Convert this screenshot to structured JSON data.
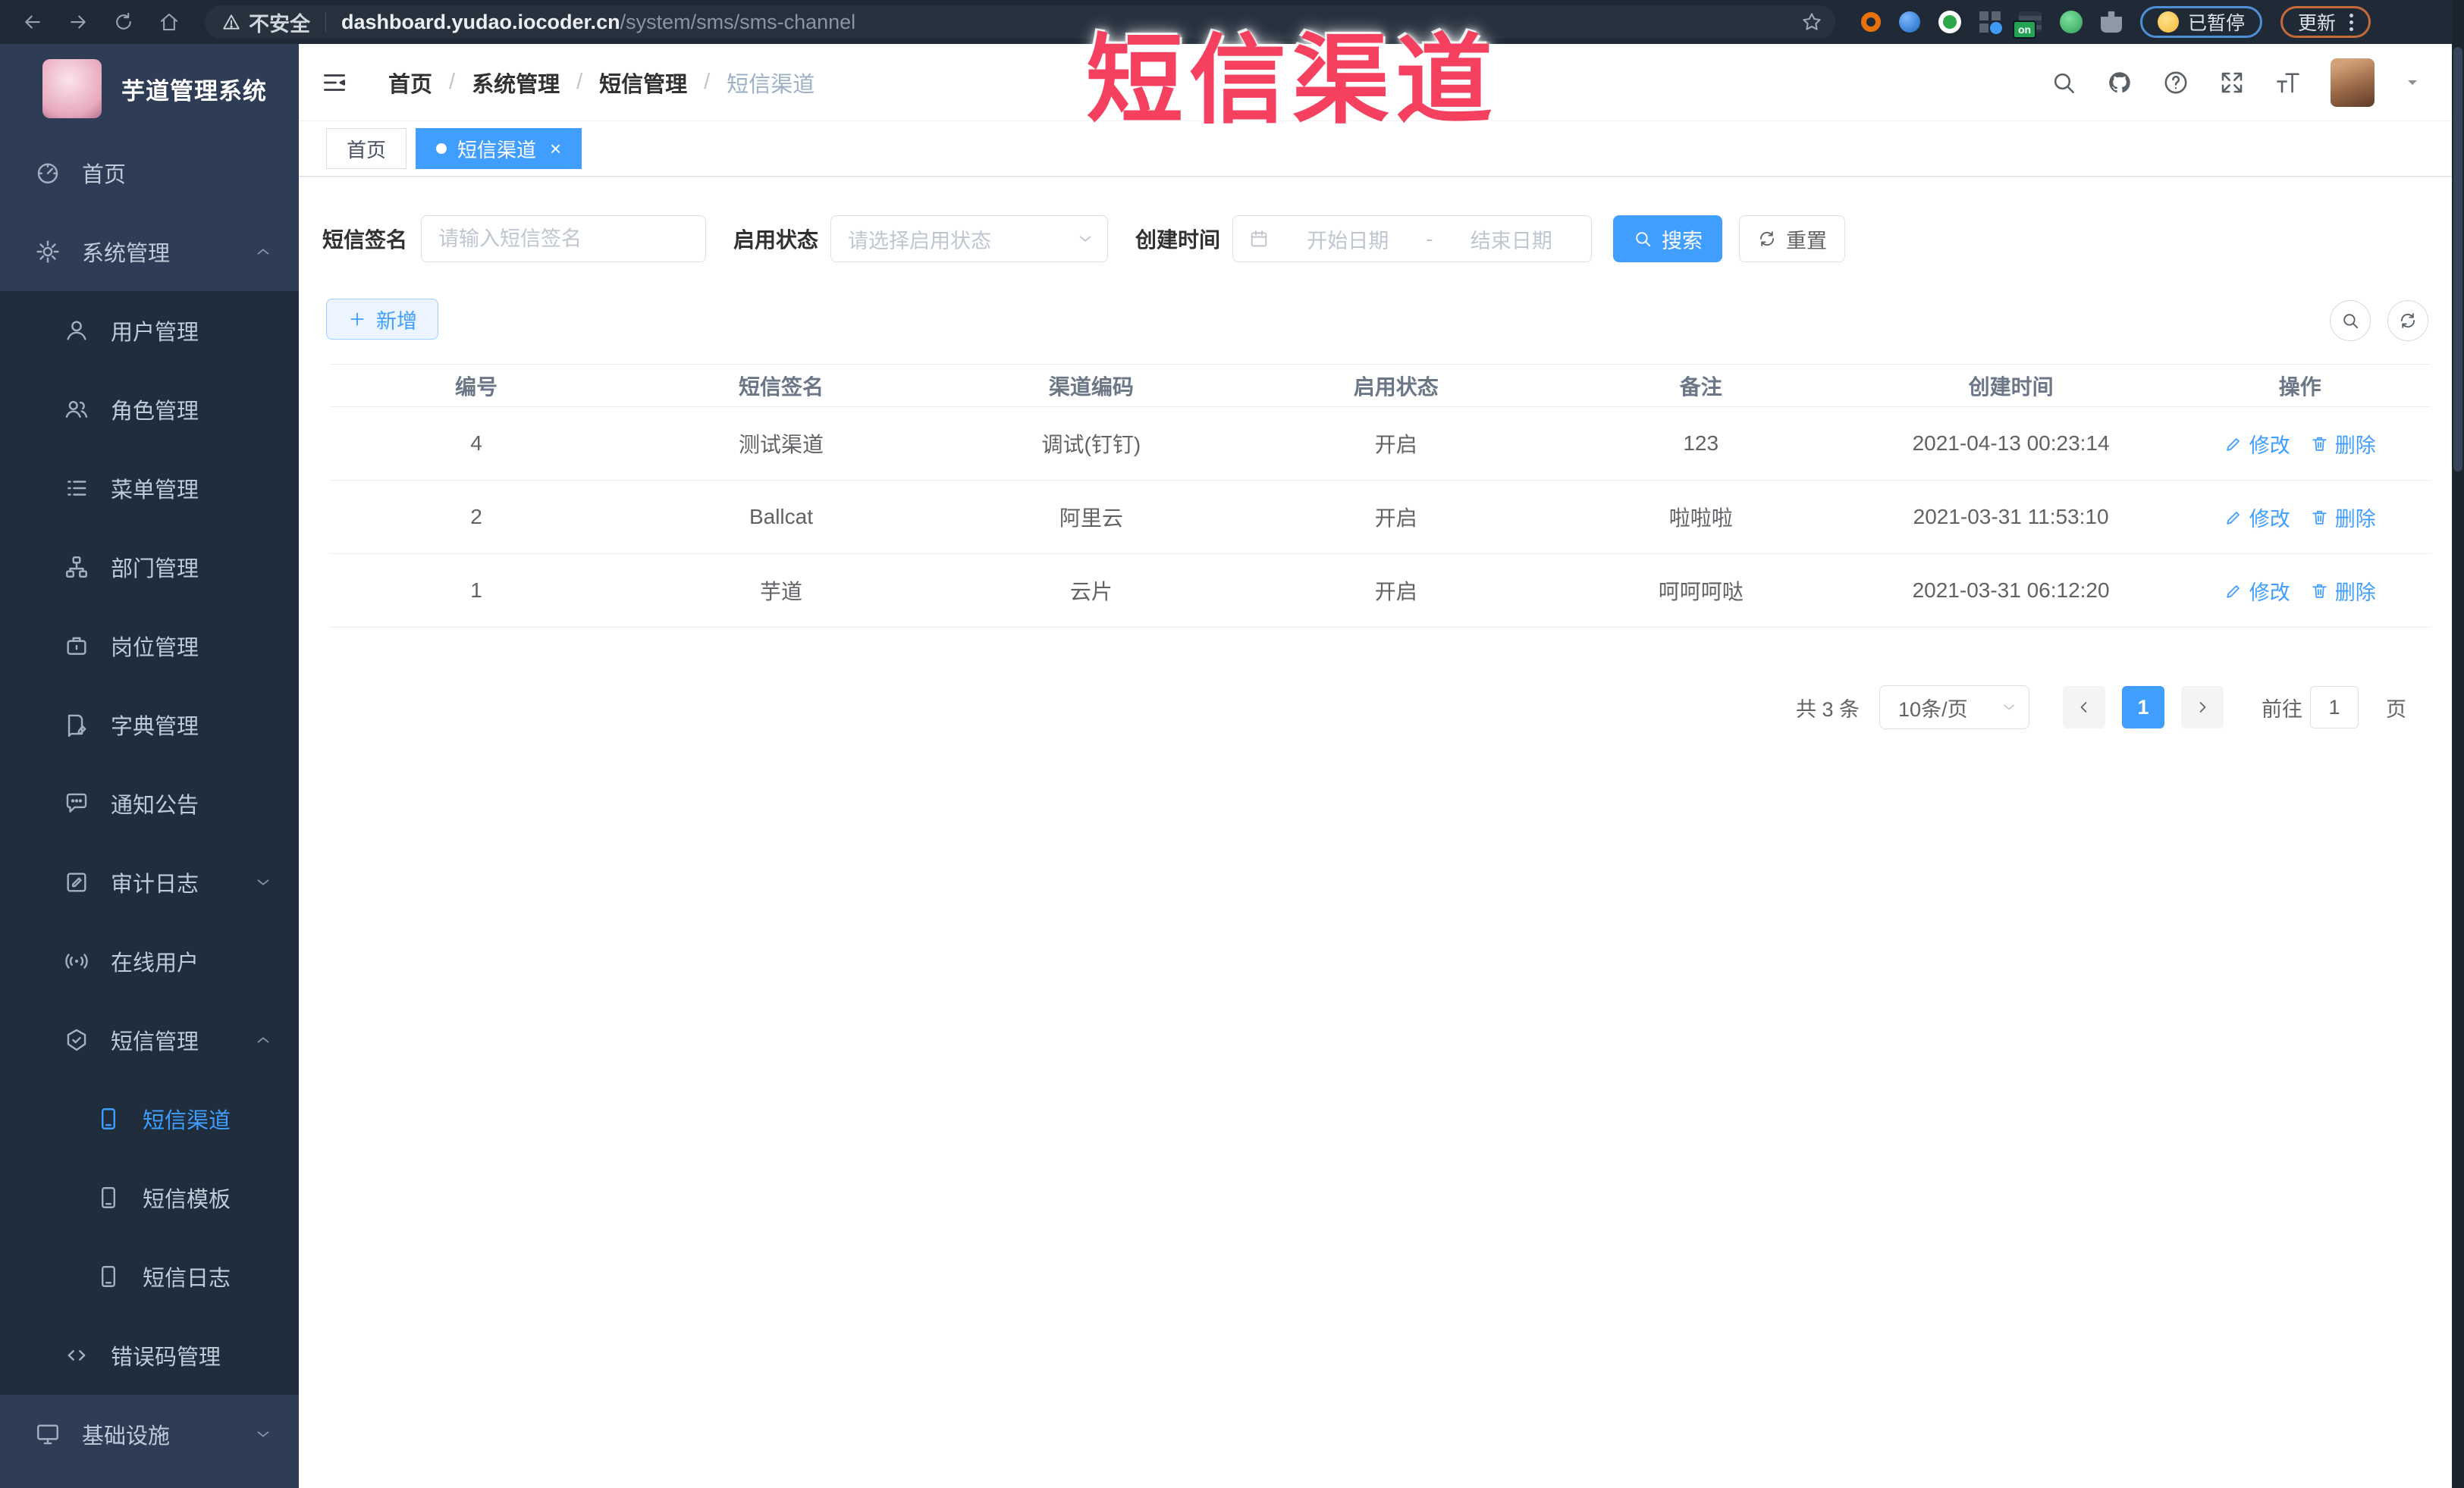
{
  "browser": {
    "security_label": "不安全",
    "url_domain": "dashboard.yudao.iocoder.cn",
    "url_path": "/system/sms/sms-channel",
    "on_badge": "on",
    "paused_label": "已暂停",
    "update_label": "更新"
  },
  "overlay": {
    "title": "短信渠道"
  },
  "sidebar": {
    "logo_title": "芋道管理系统",
    "items": [
      {
        "label": "首页",
        "icon": "dashboard-icon"
      },
      {
        "label": "系统管理",
        "icon": "gear-icon",
        "chevron": "up"
      },
      {
        "label": "用户管理",
        "icon": "user-icon"
      },
      {
        "label": "角色管理",
        "icon": "users-icon"
      },
      {
        "label": "菜单管理",
        "icon": "list-icon"
      },
      {
        "label": "部门管理",
        "icon": "tree-icon"
      },
      {
        "label": "岗位管理",
        "icon": "briefcase-icon"
      },
      {
        "label": "字典管理",
        "icon": "book-icon"
      },
      {
        "label": "通知公告",
        "icon": "chat-icon"
      },
      {
        "label": "审计日志",
        "icon": "edit-icon",
        "chevron": "down"
      },
      {
        "label": "在线用户",
        "icon": "signal-icon"
      },
      {
        "label": "短信管理",
        "icon": "shield-icon",
        "chevron": "up"
      },
      {
        "label": "短信渠道",
        "icon": "phone-icon",
        "active": true
      },
      {
        "label": "短信模板",
        "icon": "phone-icon"
      },
      {
        "label": "短信日志",
        "icon": "phone-icon"
      },
      {
        "label": "错误码管理",
        "icon": "code-icon"
      },
      {
        "label": "基础设施",
        "icon": "monitor-icon",
        "chevron": "down"
      }
    ]
  },
  "breadcrumb": {
    "separator": "/",
    "items": [
      "首页",
      "系统管理",
      "短信管理",
      "短信渠道"
    ]
  },
  "tabs": {
    "close_glyph": "×",
    "items": [
      {
        "label": "首页",
        "active": false
      },
      {
        "label": "短信渠道",
        "active": true
      }
    ]
  },
  "filters": {
    "sign_label": "短信签名",
    "sign_placeholder": "请输入短信签名",
    "status_label": "启用状态",
    "status_placeholder": "请选择启用状态",
    "time_label": "创建时间",
    "start_placeholder": "开始日期",
    "range_separator": "-",
    "end_placeholder": "结束日期",
    "search_label": "搜索",
    "reset_label": "重置"
  },
  "toolbar": {
    "add_label": "新增"
  },
  "table": {
    "headers": [
      "编号",
      "短信签名",
      "渠道编码",
      "启用状态",
      "备注",
      "创建时间",
      "操作"
    ],
    "rows": [
      [
        "4",
        "测试渠道",
        "调试(钉钉)",
        "开启",
        "123",
        "2021-04-13 00:23:14"
      ],
      [
        "2",
        "Ballcat",
        "阿里云",
        "开启",
        "啦啦啦",
        "2021-03-31 11:53:10"
      ],
      [
        "1",
        "芋道",
        "云片",
        "开启",
        "呵呵呵哒",
        "2021-03-31 06:12:20"
      ]
    ],
    "edit_label": "修改",
    "delete_label": "删除"
  },
  "pagination": {
    "total": "共 3 条",
    "page_size": "10条/页",
    "current_page": "1",
    "goto_label": "前往",
    "goto_value": "1",
    "page_unit": "页"
  },
  "colors": {
    "accent": "#409EFF",
    "overlay_pink": "#f5415f",
    "sidebar_dark": "#1f2d3d",
    "sidebar_light": "#2e3c55"
  }
}
